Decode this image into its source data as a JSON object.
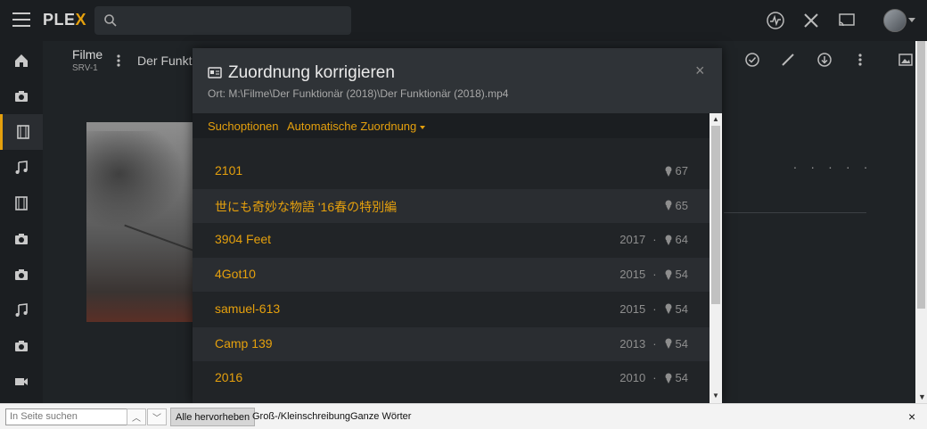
{
  "app": {
    "logo_text": "PLE",
    "logo_x": "X"
  },
  "header": {
    "library_title": "Filme",
    "library_sub": "SRV-1",
    "movie_crumb": "Der Funkt"
  },
  "modal": {
    "title": "Zuordnung korrigieren",
    "path": "Ort: M:\\Filme\\Der Funktionär (2018)\\Der Funktionär (2018).mp4",
    "close": "×",
    "toolbar": {
      "search_options": "Suchoptionen",
      "auto_match": "Automatische Zuordnung"
    },
    "results": [
      {
        "title": "2101",
        "year": "",
        "score": "67"
      },
      {
        "title": "世にも奇妙な物語 '16春の特別編",
        "year": "",
        "score": "65"
      },
      {
        "title": "3904 Feet",
        "year": "2017",
        "score": "64"
      },
      {
        "title": "4Got10",
        "year": "2015",
        "score": "54"
      },
      {
        "title": "samuel-613",
        "year": "2015",
        "score": "54"
      },
      {
        "title": "Camp 139",
        "year": "2013",
        "score": "54"
      },
      {
        "title": "2016",
        "year": "2010",
        "score": "54"
      }
    ]
  },
  "page": {
    "dots": ". . . . ."
  },
  "findbar": {
    "placeholder": "In Seite suchen",
    "highlight_all": "Alle hervorheben",
    "match_case": "Groß-/Kleinschreibung",
    "whole_words": "Ganze Wörter",
    "close": "×"
  },
  "colors": {
    "accent": "#e5a00d",
    "background": "#1f2326",
    "modal_header": "#2f3337"
  }
}
